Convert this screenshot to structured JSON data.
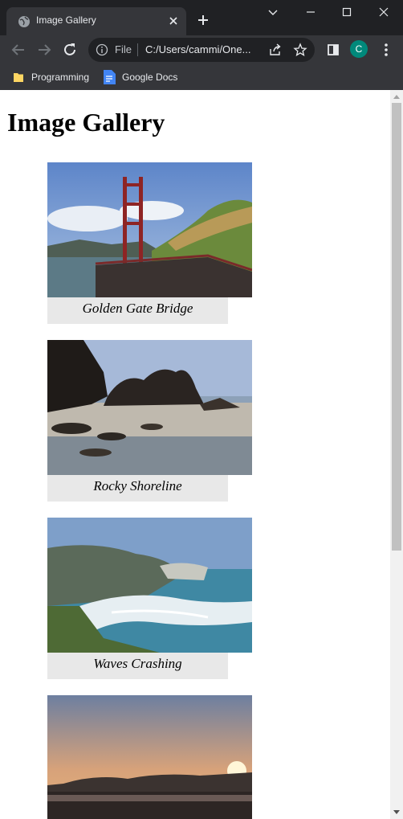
{
  "browser": {
    "tab_title": "Image Gallery",
    "omnibox": {
      "scheme_label": "File",
      "url": "C:/Users/cammi/One..."
    },
    "avatar_letter": "C",
    "bookmarks": [
      {
        "label": "Programming"
      },
      {
        "label": "Google Docs"
      }
    ]
  },
  "page": {
    "title": "Image Gallery",
    "gallery": [
      {
        "caption": "Golden Gate Bridge"
      },
      {
        "caption": "Rocky Shoreline"
      },
      {
        "caption": "Waves Crashing"
      },
      {
        "caption": ""
      }
    ]
  },
  "colors": {
    "chrome_dark": "#202124",
    "chrome_toolbar": "#35363a",
    "avatar": "#00897b",
    "caption_bg": "#e8e8e8"
  }
}
